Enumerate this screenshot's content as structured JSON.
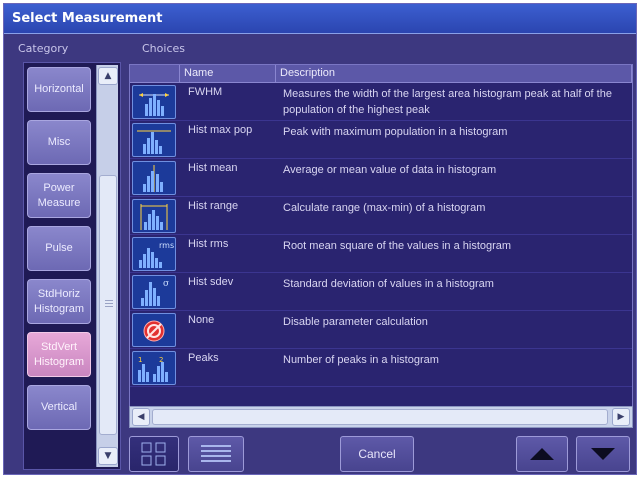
{
  "window": {
    "title": "Select Measurement"
  },
  "labels": {
    "category": "Category",
    "choices": "Choices"
  },
  "categories": [
    {
      "label": "Horizontal",
      "selected": false
    },
    {
      "label": "Misc",
      "selected": false
    },
    {
      "label": "Power\nMeasure",
      "selected": false
    },
    {
      "label": "Pulse",
      "selected": false
    },
    {
      "label": "StdHoriz\nHistogram",
      "selected": false
    },
    {
      "label": "StdVert\nHistogram",
      "selected": true
    },
    {
      "label": "Vertical",
      "selected": false
    }
  ],
  "table": {
    "headers": {
      "icon": "",
      "name": "Name",
      "description": "Description"
    },
    "rows": [
      {
        "icon": "fwhm-histogram-icon",
        "name": "FWHM",
        "description": "Measures the width of the largest area histogram peak at half of the population of the highest peak"
      },
      {
        "icon": "hist-max-pop-icon",
        "name": "Hist max pop",
        "description": "Peak with maximum population in a histogram"
      },
      {
        "icon": "hist-mean-icon",
        "name": "Hist mean",
        "description": "Average or mean value of data in histogram"
      },
      {
        "icon": "hist-range-icon",
        "name": "Hist range",
        "description": "Calculate range (max-min) of a histogram"
      },
      {
        "icon": "hist-rms-icon",
        "name": "Hist rms",
        "description": "Root mean square of the values in a histogram"
      },
      {
        "icon": "hist-sdev-icon",
        "name": "Hist sdev",
        "description": "Standard deviation of values in a histogram"
      },
      {
        "icon": "none-disabled-icon",
        "name": "None",
        "description": "Disable parameter calculation"
      },
      {
        "icon": "peaks-histogram-icon",
        "name": "Peaks",
        "description": "Number of peaks in a histogram"
      }
    ]
  },
  "buttons": {
    "cancel": "Cancel",
    "icon_view": "icon-view-icon",
    "list_view": "list-view-icon",
    "up": "up-arrow-icon",
    "down": "down-arrow-icon"
  },
  "colors": {
    "selected_category": "#d89bd0",
    "panel": "#3d3880",
    "title_bar": "#2f4fc4"
  }
}
